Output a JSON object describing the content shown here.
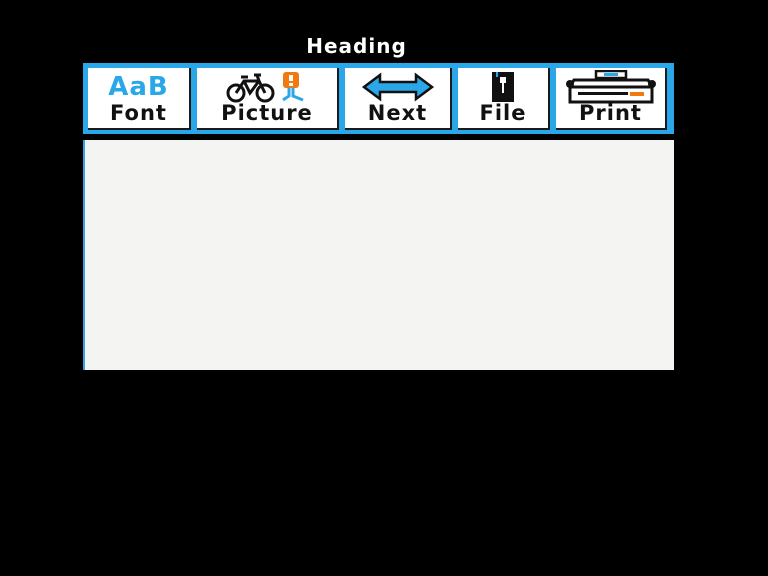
{
  "window": {
    "heading": "Heading"
  },
  "toolbar": {
    "accent_color": "#2aa7e8",
    "tools": [
      {
        "label": "Font",
        "icon_text": "AaB",
        "icon": "font-icon"
      },
      {
        "label": "Picture",
        "icon": "bicycle-picture-icon"
      },
      {
        "label": "Next",
        "icon": "double-arrow-icon"
      },
      {
        "label": "File",
        "icon": "file-drawer-icon"
      },
      {
        "label": "Print",
        "icon": "printer-icon"
      }
    ]
  },
  "canvas": {
    "content": ""
  }
}
